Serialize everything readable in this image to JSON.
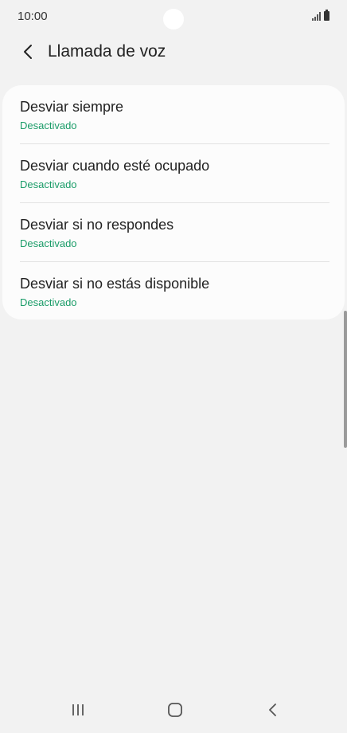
{
  "status_bar": {
    "time": "10:00"
  },
  "header": {
    "title": "Llamada de voz"
  },
  "forwarding_options": [
    {
      "title": "Desviar siempre",
      "status": "Desactivado"
    },
    {
      "title": "Desviar cuando esté ocupado",
      "status": "Desactivado"
    },
    {
      "title": "Desviar si no respondes",
      "status": "Desactivado"
    },
    {
      "title": "Desviar si no estás disponible",
      "status": "Desactivado"
    }
  ],
  "colors": {
    "accent_status": "#1a9c68",
    "background": "#f2f2f2",
    "card": "#fcfcfc"
  },
  "icons": {
    "back": "chevron-left-icon",
    "signal": "signal-icon",
    "battery": "battery-icon",
    "recents": "recent-apps-icon",
    "home": "home-icon",
    "nav_back": "back-icon"
  }
}
